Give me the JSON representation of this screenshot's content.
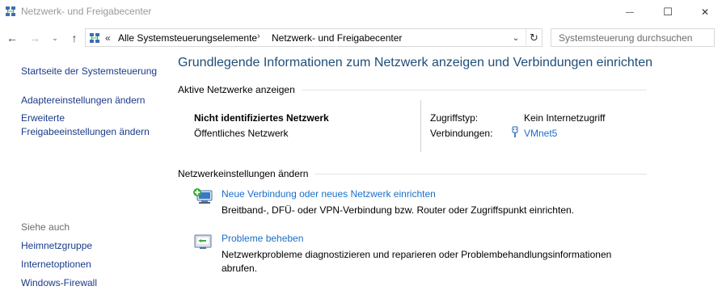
{
  "window": {
    "title": "Netzwerk- und Freigabecenter",
    "minimize_glyph": "—",
    "maximize_glyph": "☐",
    "close_glyph": "✕"
  },
  "nav": {
    "back_glyph": "←",
    "forward_glyph": "→",
    "recent_glyph": "⌄",
    "up_glyph": "↑",
    "address": {
      "overflow_glyph": "«",
      "crumbs": [
        "Alle Systemsteuerungselemente",
        "Netzwerk- und Freigabecenter"
      ],
      "separator": "›",
      "dropdown_glyph": "⌄",
      "refresh_glyph": "↻"
    },
    "search": {
      "placeholder": "Systemsteuerung durchsuchen"
    }
  },
  "sidebar": {
    "home": "Startseite der Systemsteuerung",
    "links": [
      "Adaptereinstellungen ändern",
      "Erweiterte",
      "Freigabeeinstellungen ändern"
    ],
    "see_also_heading": "Siehe auch",
    "see_also": [
      "Heimnetzgruppe",
      "Internetoptionen",
      "Windows-Firewall"
    ]
  },
  "main": {
    "title": "Grundlegende Informationen zum Netzwerk anzeigen und Verbindungen einrichten",
    "active_section": "Aktive Netzwerke anzeigen",
    "network": {
      "name": "Nicht identifiziertes Netzwerk",
      "type": "Öffentliches Netzwerk",
      "access_label": "Zugriffstyp:",
      "access_value": "Kein Internetzugriff",
      "connections_label": "Verbindungen:",
      "connection_name": "VMnet5"
    },
    "settings_section": "Netzwerkeinstellungen ändern",
    "tasks": [
      {
        "icon": "new-connection-icon",
        "title": "Neue Verbindung oder neues Netzwerk einrichten",
        "desc": "Breitband-, DFÜ- oder VPN-Verbindung bzw. Router oder Zugriffspunkt einrichten."
      },
      {
        "icon": "troubleshoot-icon",
        "title": "Probleme beheben",
        "desc": "Netzwerkprobleme diagnostizieren und reparieren oder Problembehandlungsinformationen abrufen."
      }
    ]
  },
  "colors": {
    "link": "#1a6fc9",
    "sidebar_link": "#1a3a8a",
    "title": "#1e4e79",
    "muted": "#6d6d6d"
  }
}
